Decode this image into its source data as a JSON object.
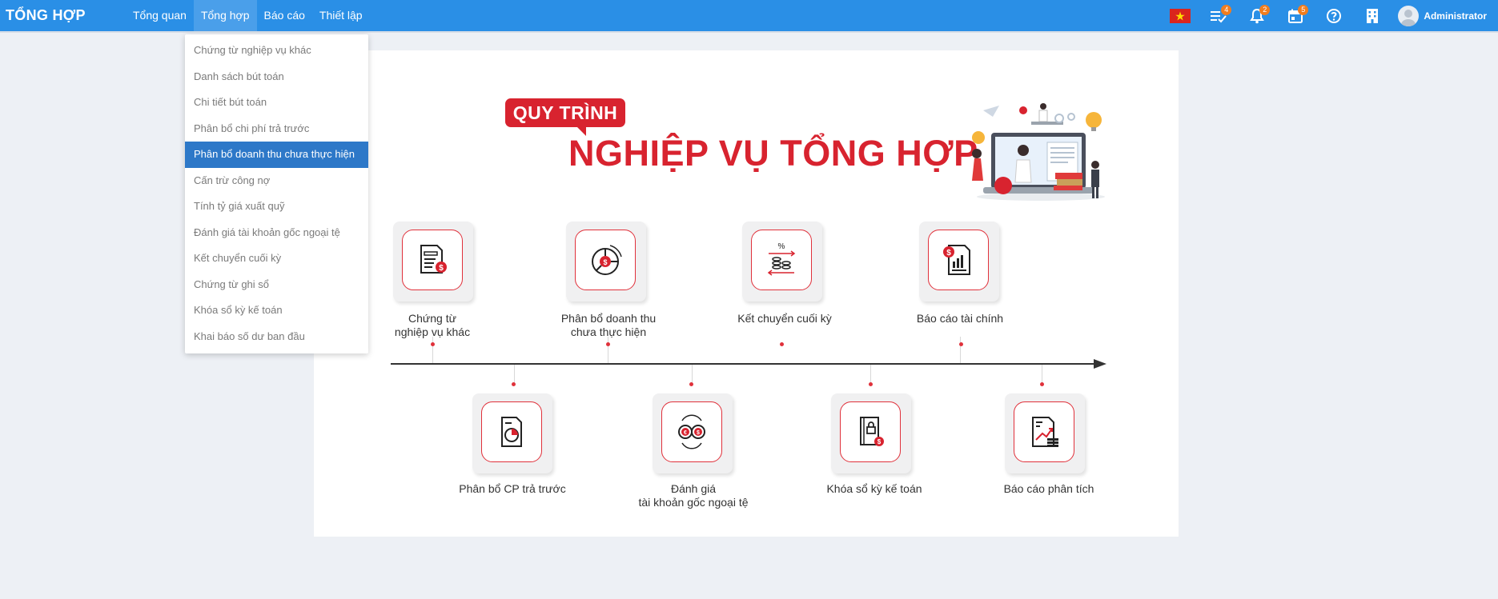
{
  "app": {
    "brand": "TỔNG HỢP"
  },
  "nav": [
    "Tổng quan",
    "Tổng hợp",
    "Báo cáo",
    "Thiết lập"
  ],
  "tools": [
    {
      "icon": "vietnam-flag-icon"
    },
    {
      "icon": "task-list-icon",
      "badge": "4"
    },
    {
      "icon": "bell-icon",
      "badge": "2"
    },
    {
      "icon": "calendar-icon",
      "badge": "5"
    },
    {
      "icon": "help-icon"
    },
    {
      "icon": "building-icon"
    }
  ],
  "user": {
    "name": "Administrator"
  },
  "dropdown": {
    "items": [
      "Chứng từ nghiệp vụ khác",
      "Danh sách bút toán",
      "Chi tiết bút toán",
      "Phân bổ chi phí trả trước",
      "Phân bổ doanh thu chưa thực hiện",
      "Cấn trừ công nợ",
      "Tính tỷ giá xuất quỹ",
      "Đánh giá tài khoản gốc ngoại tệ",
      "Kết chuyển cuối kỳ",
      "Chứng từ ghi sổ",
      "Khóa sổ kỳ kế toán",
      "Khai báo số dư ban đầu"
    ],
    "active_index": 4
  },
  "infographic": {
    "tag": "QUY TRÌNH",
    "title": "NGHIỆP VỤ TỔNG HỢP",
    "steps_top": [
      {
        "label_lines": [
          "Chứng từ",
          "nghiệp vụ khác"
        ],
        "icon": "document-dollar-icon"
      },
      {
        "label_lines": [
          "Phân bổ doanh thu",
          "chưa thực hiện"
        ],
        "icon": "pie-chart-dollar-icon"
      },
      {
        "label_lines": [
          "Kết chuyển cuối kỳ"
        ],
        "icon": "coins-transfer-icon"
      },
      {
        "label_lines": [
          "Báo cáo tài chính"
        ],
        "icon": "financial-report-icon"
      }
    ],
    "steps_bottom": [
      {
        "label_lines": [
          "Phân bổ CP trả trước"
        ],
        "icon": "report-pie-icon"
      },
      {
        "label_lines": [
          "Đánh giá",
          "tài khoản gốc ngoại tệ"
        ],
        "icon": "currency-exchange-icon"
      },
      {
        "label_lines": [
          "Khóa sổ kỳ kế toán"
        ],
        "icon": "locked-book-icon"
      },
      {
        "label_lines": [
          "Báo cáo phân tích"
        ],
        "icon": "analysis-report-icon"
      }
    ]
  }
}
